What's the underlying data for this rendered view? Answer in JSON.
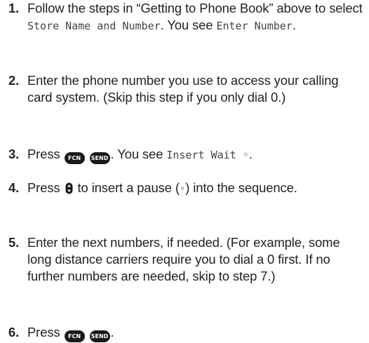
{
  "steps": [
    {
      "number": "1.",
      "text_a": "Follow the steps in “Getting to Phone Book” above to select ",
      "lcd_a": "Store Name and Number",
      "text_b": ". You see ",
      "lcd_b": "Enter Number",
      "text_c": "."
    },
    {
      "number": "2.",
      "text": "Enter the phone number you use to access your calling card system. (Skip this step if you only dial 0.)"
    },
    {
      "number": "3.",
      "text_a": "Press ",
      "key_fcn": "FCN",
      "key_send": "SEND",
      "text_b": ". You see ",
      "lcd": "Insert Wait ◦",
      "text_c": "."
    },
    {
      "number": "4.",
      "text_a": "Press ",
      "icon": "up-down-navigation-icon",
      "text_b": " to insert a pause (",
      "pause_symbol": "◦",
      "text_c": ") into the sequence."
    },
    {
      "number": "5.",
      "text": "Enter the next numbers, if needed. (For example, some long distance carriers require you to dial a 0 first. If no further numbers are needed, skip to step 7.)"
    },
    {
      "number": "6.",
      "text_a": "Press ",
      "key_fcn": "FCN",
      "key_send": "SEND",
      "text_b": "."
    }
  ]
}
